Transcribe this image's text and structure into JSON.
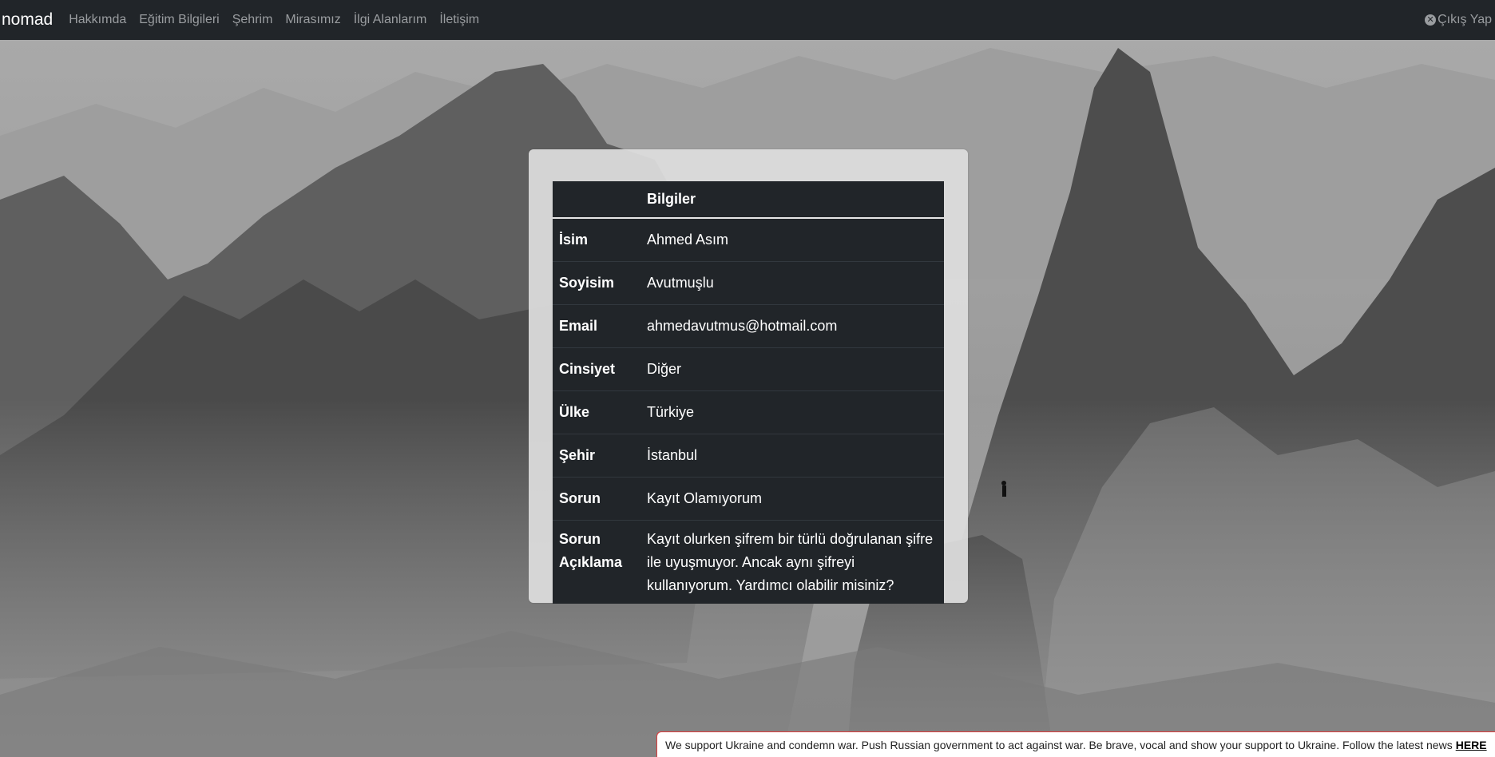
{
  "navbar": {
    "brand": "nomad",
    "links": [
      "Hakkımda",
      "Eğitim Bilgileri",
      "Şehrim",
      "Mirasımız",
      "İlgi Alanlarım",
      "İletişim"
    ],
    "logout_label": "Çıkış Yap"
  },
  "table": {
    "header": "Bilgiler",
    "rows": [
      {
        "key": "İsim",
        "value": "Ahmed Asım"
      },
      {
        "key": "Soyisim",
        "value": "Avutmuşlu"
      },
      {
        "key": "Email",
        "value": "ahmedavutmus@hotmail.com"
      },
      {
        "key": "Cinsiyet",
        "value": "Diğer"
      },
      {
        "key": "Ülke",
        "value": "Türkiye"
      },
      {
        "key": "Şehir",
        "value": "İstanbul"
      },
      {
        "key": "Sorun",
        "value": "Kayıt Olamıyorum"
      },
      {
        "key": "Sorun Açıklama",
        "value": "Kayıt olurken şifrem bir türlü doğrulanan şifre ile uyuşmuyor. Ancak aynı şifreyi kullanıyorum. Yardımcı olabilir misiniz?"
      }
    ]
  },
  "banner": {
    "text": "We support Ukraine and condemn war. Push Russian government to act against war. Be brave, vocal and show your support to Ukraine. Follow the latest news",
    "link": "HERE",
    "border_color": "#e03b3b"
  },
  "colors": {
    "navbar_bg": "#212529",
    "table_bg": "#212529",
    "nav_link": "#9a9da0"
  }
}
